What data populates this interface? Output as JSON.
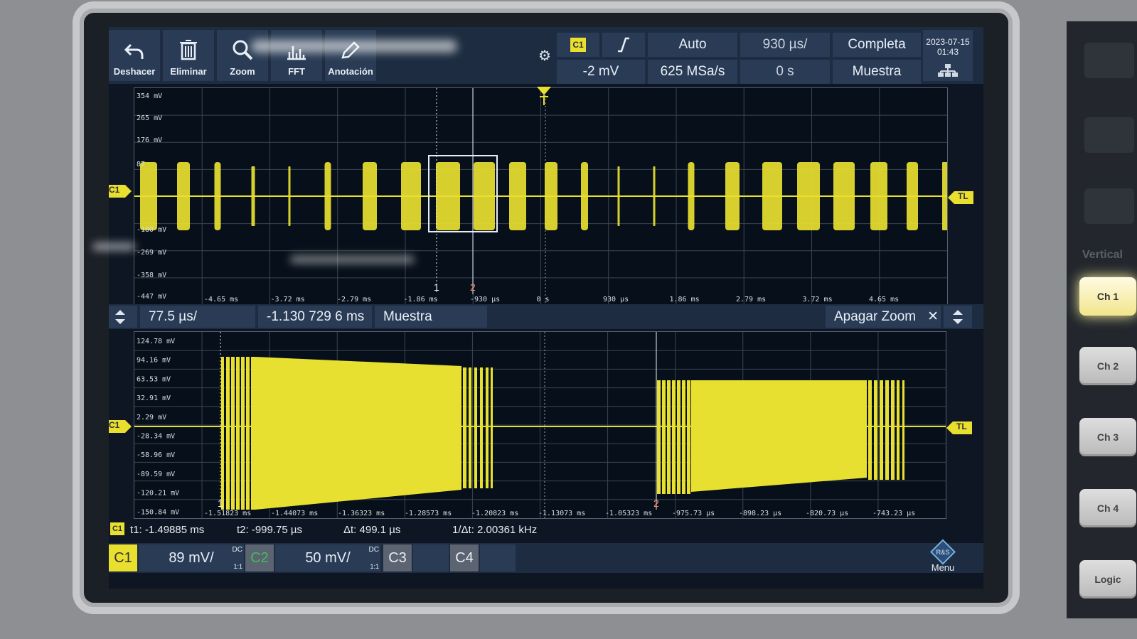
{
  "toolbar": {
    "tools": [
      "Deshacer",
      "Eliminar",
      "Zoom",
      "FFT",
      "Anotación"
    ],
    "trigger_source": "C1",
    "trigger_level": "-2 mV",
    "trigger_mode": "Auto",
    "sample_rate": "625 MSa/s",
    "timebase": "930 µs/",
    "time_offset": "0 s",
    "acquisition": "Completa",
    "acq_mode": "Muestra",
    "date": "2023-07-15",
    "time": "01:43"
  },
  "overview": {
    "channel_tag": "C1",
    "right_tag": "TL",
    "y_labels": [
      "354 mV",
      "265 mV",
      "176 mV",
      "87",
      "-180 mV",
      "-269 mV",
      "-358 mV",
      "-447 mV"
    ],
    "x_labels": [
      "-4.65 ms",
      "-3.72 ms",
      "-2.79 ms",
      "-1.86 ms",
      "-930 µs",
      "0 s",
      "930 µs",
      "1.86 ms",
      "2.79 ms",
      "3.72 ms",
      "4.65 ms"
    ],
    "cursor1": "1",
    "cursor2": "2"
  },
  "zoombar": {
    "scale": "77.5 µs/",
    "position": "-1.130 729 6 ms",
    "mode": "Muestra",
    "off": "Apagar Zoom",
    "close": "✕"
  },
  "detail": {
    "channel_tag": "C1",
    "right_tag": "TL",
    "y_labels": [
      "124.78 mV",
      "94.16 mV",
      "63.53 mV",
      "32.91 mV",
      "2.29 mV",
      "-28.34 mV",
      "-58.96 mV",
      "-89.59 mV",
      "-120.21 mV",
      "-150.84 mV"
    ],
    "x_labels": [
      "-1.51823 ms",
      "-1.44073 ms",
      "-1.36323 ms",
      "-1.28573 ms",
      "-1.20823 ms",
      "-1.13073 ms",
      "-1.05323 ms",
      "-975.73 µs",
      "-898.23 µs",
      "-820.73 µs",
      "-743.23 µs"
    ],
    "cursor1": "1",
    "cursor2": "2"
  },
  "measurements": {
    "tag": "C1",
    "t1": "t1: -1.49885 ms",
    "t2": "t2: -999.75 µs",
    "dt": "Δt: 499.1 µs",
    "inv_dt": "1/Δt: 2.00361 kHz"
  },
  "channels": {
    "c1": {
      "label": "C1",
      "scale": "89 mV/",
      "coupling": "DC",
      "ratio": "1:1"
    },
    "c2": {
      "label": "C2",
      "scale": "50 mV/",
      "coupling": "DC",
      "ratio": "1:1"
    },
    "c3": {
      "label": "C3"
    },
    "c4": {
      "label": "C4"
    },
    "menu": "Menu",
    "logo": "R&S"
  },
  "hardware": {
    "section": "Vertical",
    "buttons": [
      "Ch 1",
      "Ch 2",
      "Ch 3",
      "Ch 4",
      "Logic"
    ]
  },
  "colors": {
    "trace": "#e8e030",
    "c2": "#3fbf5f",
    "panel": "#2a3c55",
    "bar": "#1d2c40"
  }
}
